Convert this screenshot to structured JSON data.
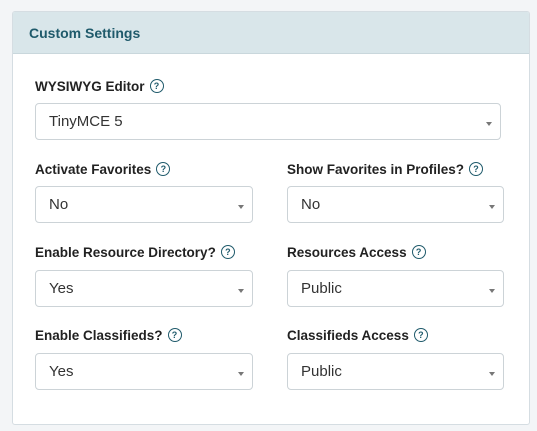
{
  "panel": {
    "title": "Custom Settings"
  },
  "fields": {
    "wysiwyg": {
      "label": "WYSIWYG Editor",
      "value": "TinyMCE 5"
    },
    "activate_favorites": {
      "label": "Activate Favorites",
      "value": "No"
    },
    "show_favorites_profiles": {
      "label": "Show Favorites in Profiles?",
      "value": "No"
    },
    "enable_resource_directory": {
      "label": "Enable Resource Directory?",
      "value": "Yes"
    },
    "resources_access": {
      "label": "Resources Access",
      "value": "Public"
    },
    "enable_classifieds": {
      "label": "Enable Classifieds?",
      "value": "Yes"
    },
    "classifieds_access": {
      "label": "Classifieds Access",
      "value": "Public"
    }
  },
  "icons": {
    "help": "question-circle-icon",
    "dropdown": "caret-down-icon"
  },
  "help_glyph": "?",
  "colors": {
    "header_bg": "#d9e6ea",
    "title_text": "#1f5a6b",
    "help_icon": "#1f5a6b",
    "field_border": "#ccd3d7"
  }
}
